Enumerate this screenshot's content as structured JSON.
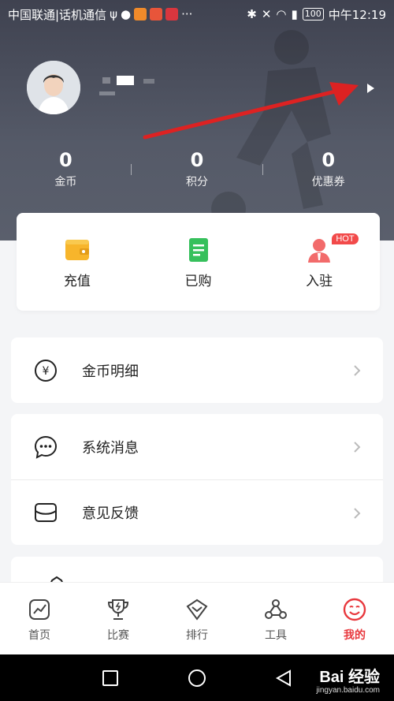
{
  "status_bar": {
    "carrier": "中国联通|话机通信",
    "battery": "100",
    "time": "中午12:19"
  },
  "profile": {
    "avatar_icon": "user-avatar-icon",
    "arrow_icon": "play-arrow-icon"
  },
  "stats": [
    {
      "value": "0",
      "label": "金币"
    },
    {
      "value": "0",
      "label": "积分"
    },
    {
      "value": "0",
      "label": "优惠券"
    }
  ],
  "quick_actions": [
    {
      "label": "充值",
      "icon": "wallet-icon",
      "color": "#f7b52b"
    },
    {
      "label": "已购",
      "icon": "document-icon",
      "color": "#36c05c"
    },
    {
      "label": "入驻",
      "icon": "person-icon",
      "color": "#f26b6b",
      "badge": "HOT"
    }
  ],
  "menu_groups": [
    [
      {
        "label": "金币明细",
        "icon": "yen-coin-icon"
      }
    ],
    [
      {
        "label": "系统消息",
        "icon": "chat-bubble-icon"
      },
      {
        "label": "意见反馈",
        "icon": "envelope-icon"
      }
    ]
  ],
  "tabs": [
    {
      "label": "首页",
      "icon": "chart-square-icon",
      "active": false
    },
    {
      "label": "比赛",
      "icon": "trophy-icon",
      "active": false
    },
    {
      "label": "排行",
      "icon": "diamond-icon",
      "active": false
    },
    {
      "label": "工具",
      "icon": "nodes-icon",
      "active": false
    },
    {
      "label": "我的",
      "icon": "smiley-icon",
      "active": true
    }
  ],
  "watermark": {
    "brand": "Bai 经验",
    "url": "jingyan.baidu.com"
  },
  "colors": {
    "accent": "#e8383d",
    "header_bg": "#4a4d5a"
  }
}
